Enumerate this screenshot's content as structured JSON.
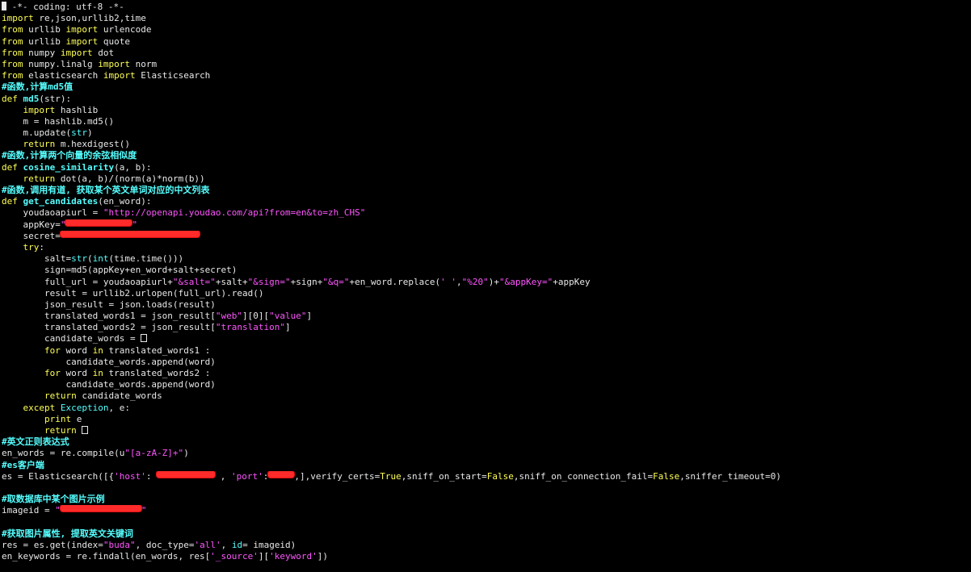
{
  "lines": [
    [
      {
        "t": "",
        "c": "cursor"
      },
      {
        "t": " -*- coding: utf-8 -*-",
        "c": "tok-plain"
      }
    ],
    [
      {
        "t": "import",
        "c": "tok-kw"
      },
      {
        "t": " re,json,urllib2,time",
        "c": "tok-plain"
      }
    ],
    [
      {
        "t": "from",
        "c": "tok-kw"
      },
      {
        "t": " urllib ",
        "c": "tok-plain"
      },
      {
        "t": "import",
        "c": "tok-kw"
      },
      {
        "t": " urlencode",
        "c": "tok-plain"
      }
    ],
    [
      {
        "t": "from",
        "c": "tok-kw"
      },
      {
        "t": " urllib ",
        "c": "tok-plain"
      },
      {
        "t": "import",
        "c": "tok-kw"
      },
      {
        "t": " quote",
        "c": "tok-plain"
      }
    ],
    [
      {
        "t": "from",
        "c": "tok-kw"
      },
      {
        "t": " numpy ",
        "c": "tok-plain"
      },
      {
        "t": "import",
        "c": "tok-kw"
      },
      {
        "t": " dot",
        "c": "tok-plain"
      }
    ],
    [
      {
        "t": "from",
        "c": "tok-kw"
      },
      {
        "t": " numpy.linalg ",
        "c": "tok-plain"
      },
      {
        "t": "import",
        "c": "tok-kw"
      },
      {
        "t": " norm",
        "c": "tok-plain"
      }
    ],
    [
      {
        "t": "from",
        "c": "tok-kw"
      },
      {
        "t": " elasticsearch ",
        "c": "tok-plain"
      },
      {
        "t": "import",
        "c": "tok-kw"
      },
      {
        "t": " Elasticsearch",
        "c": "tok-plain"
      }
    ],
    [
      {
        "t": "#函数,计算md5值",
        "c": "tok-cm"
      }
    ],
    [
      {
        "t": "def",
        "c": "tok-kw"
      },
      {
        "t": " ",
        "c": "tok-plain"
      },
      {
        "t": "md5",
        "c": "tok-def"
      },
      {
        "t": "(str):",
        "c": "tok-plain"
      }
    ],
    [
      {
        "t": "    ",
        "c": "tok-plain"
      },
      {
        "t": "import",
        "c": "tok-kw"
      },
      {
        "t": " hashlib",
        "c": "tok-plain"
      }
    ],
    [
      {
        "t": "    m = hashlib.md5()",
        "c": "tok-plain"
      }
    ],
    [
      {
        "t": "    m.update(",
        "c": "tok-plain"
      },
      {
        "t": "str",
        "c": "tok-bi"
      },
      {
        "t": ")",
        "c": "tok-plain"
      }
    ],
    [
      {
        "t": "    ",
        "c": "tok-plain"
      },
      {
        "t": "return",
        "c": "tok-kw"
      },
      {
        "t": " m.hexdigest()",
        "c": "tok-plain"
      }
    ],
    [
      {
        "t": "#函数,计算两个向量的余弦相似度",
        "c": "tok-cm"
      }
    ],
    [
      {
        "t": "def",
        "c": "tok-kw"
      },
      {
        "t": " ",
        "c": "tok-plain"
      },
      {
        "t": "cosine_similarity",
        "c": "tok-def"
      },
      {
        "t": "(a, b):",
        "c": "tok-plain"
      }
    ],
    [
      {
        "t": "    ",
        "c": "tok-plain"
      },
      {
        "t": "return",
        "c": "tok-kw"
      },
      {
        "t": " dot(a, b)/(norm(a)*norm(b))",
        "c": "tok-plain"
      }
    ],
    [
      {
        "t": "#函数,调用有道, 获取某个英文单词对应的中文列表",
        "c": "tok-cm"
      }
    ],
    [
      {
        "t": "def",
        "c": "tok-kw"
      },
      {
        "t": " ",
        "c": "tok-plain"
      },
      {
        "t": "get_candidates",
        "c": "tok-def"
      },
      {
        "t": "(en_word):",
        "c": "tok-plain"
      }
    ],
    [
      {
        "t": "    youdaoapiurl = ",
        "c": "tok-plain"
      },
      {
        "t": "\"http://openapi.youdao.com/api?from=en&to=zh_CHS\"",
        "c": "tok-str"
      }
    ],
    [
      {
        "t": "    appKey=",
        "c": "tok-plain"
      },
      {
        "t": "\"",
        "c": "tok-str"
      },
      {
        "t": "",
        "c": "redact",
        "w": 82
      },
      {
        "t": "\"",
        "c": "tok-str"
      }
    ],
    [
      {
        "t": "    secret=",
        "c": "tok-plain"
      },
      {
        "t": "",
        "c": "redact",
        "w": 172
      }
    ],
    [
      {
        "t": "    ",
        "c": "tok-plain"
      },
      {
        "t": "try",
        "c": "tok-kw"
      },
      {
        "t": ":",
        "c": "tok-plain"
      }
    ],
    [
      {
        "t": "        salt=",
        "c": "tok-plain"
      },
      {
        "t": "str",
        "c": "tok-bi"
      },
      {
        "t": "(",
        "c": "tok-plain"
      },
      {
        "t": "int",
        "c": "tok-bi"
      },
      {
        "t": "(time.time()))",
        "c": "tok-plain"
      }
    ],
    [
      {
        "t": "        sign=md5(appKey+en_word+salt+secret)",
        "c": "tok-plain"
      }
    ],
    [
      {
        "t": "        full_url = youdaoapiurl+",
        "c": "tok-plain"
      },
      {
        "t": "\"&salt=\"",
        "c": "tok-str"
      },
      {
        "t": "+salt+",
        "c": "tok-plain"
      },
      {
        "t": "\"&sign=\"",
        "c": "tok-str"
      },
      {
        "t": "+sign+",
        "c": "tok-plain"
      },
      {
        "t": "\"&q=\"",
        "c": "tok-str"
      },
      {
        "t": "+en_word.replace(",
        "c": "tok-plain"
      },
      {
        "t": "' '",
        "c": "tok-str"
      },
      {
        "t": ",",
        "c": "tok-plain"
      },
      {
        "t": "\"%20\"",
        "c": "tok-str"
      },
      {
        "t": ")+",
        "c": "tok-plain"
      },
      {
        "t": "\"&appKey=\"",
        "c": "tok-str"
      },
      {
        "t": "+appKey",
        "c": "tok-plain"
      }
    ],
    [
      {
        "t": "        result = urllib2.urlopen(full_url).read()",
        "c": "tok-plain"
      }
    ],
    [
      {
        "t": "        json_result = json.loads(result)",
        "c": "tok-plain"
      }
    ],
    [
      {
        "t": "        translated_words1 = json_result[",
        "c": "tok-plain"
      },
      {
        "t": "\"web\"",
        "c": "tok-str"
      },
      {
        "t": "][0][",
        "c": "tok-plain"
      },
      {
        "t": "\"value\"",
        "c": "tok-str"
      },
      {
        "t": "]",
        "c": "tok-plain"
      }
    ],
    [
      {
        "t": "        translated_words2 = json_result[",
        "c": "tok-plain"
      },
      {
        "t": "\"translation\"",
        "c": "tok-str"
      },
      {
        "t": "]",
        "c": "tok-plain"
      }
    ],
    [
      {
        "t": "        candidate_words = ",
        "c": "tok-plain"
      },
      {
        "t": "",
        "c": "box"
      }
    ],
    [
      {
        "t": "        ",
        "c": "tok-plain"
      },
      {
        "t": "for",
        "c": "tok-kw"
      },
      {
        "t": " word ",
        "c": "tok-plain"
      },
      {
        "t": "in",
        "c": "tok-kw"
      },
      {
        "t": " translated_words1 :",
        "c": "tok-plain"
      }
    ],
    [
      {
        "t": "            candidate_words.append(word)",
        "c": "tok-plain"
      }
    ],
    [
      {
        "t": "        ",
        "c": "tok-plain"
      },
      {
        "t": "for",
        "c": "tok-kw"
      },
      {
        "t": " word ",
        "c": "tok-plain"
      },
      {
        "t": "in",
        "c": "tok-kw"
      },
      {
        "t": " translated_words2 :",
        "c": "tok-plain"
      }
    ],
    [
      {
        "t": "            candidate_words.append(word)",
        "c": "tok-plain"
      }
    ],
    [
      {
        "t": "        ",
        "c": "tok-plain"
      },
      {
        "t": "return",
        "c": "tok-kw"
      },
      {
        "t": " candidate_words",
        "c": "tok-plain"
      }
    ],
    [
      {
        "t": "    ",
        "c": "tok-plain"
      },
      {
        "t": "except",
        "c": "tok-kw"
      },
      {
        "t": " ",
        "c": "tok-plain"
      },
      {
        "t": "Exception",
        "c": "tok-bi"
      },
      {
        "t": ", e:",
        "c": "tok-plain"
      }
    ],
    [
      {
        "t": "        ",
        "c": "tok-plain"
      },
      {
        "t": "print",
        "c": "tok-kw"
      },
      {
        "t": " e",
        "c": "tok-plain"
      }
    ],
    [
      {
        "t": "        ",
        "c": "tok-plain"
      },
      {
        "t": "return",
        "c": "tok-kw"
      },
      {
        "t": " ",
        "c": "tok-plain"
      },
      {
        "t": "",
        "c": "box"
      }
    ],
    [
      {
        "t": "#英文正则表达式",
        "c": "tok-cm"
      }
    ],
    [
      {
        "t": "en_words = re.compile(u",
        "c": "tok-plain"
      },
      {
        "t": "\"[a-zA-Z]+\"",
        "c": "tok-str"
      },
      {
        "t": ")",
        "c": "tok-plain"
      }
    ],
    [
      {
        "t": "#es客户端",
        "c": "tok-cm"
      }
    ],
    [
      {
        "t": "es = Elasticsearch([{",
        "c": "tok-plain"
      },
      {
        "t": "'host'",
        "c": "tok-str"
      },
      {
        "t": ": ",
        "c": "tok-plain"
      },
      {
        "t": "",
        "c": "redact",
        "w": 72
      },
      {
        "t": " , ",
        "c": "tok-plain"
      },
      {
        "t": "'port'",
        "c": "tok-str"
      },
      {
        "t": ":",
        "c": "tok-plain"
      },
      {
        "t": "",
        "c": "redact",
        "w": 32
      },
      {
        "t": ",],verify_certs=",
        "c": "tok-plain"
      },
      {
        "t": "True",
        "c": "tok-kw"
      },
      {
        "t": ",sniff_on_start=",
        "c": "tok-plain"
      },
      {
        "t": "False",
        "c": "tok-kw"
      },
      {
        "t": ",sniff_on_connection_fail=",
        "c": "tok-plain"
      },
      {
        "t": "False",
        "c": "tok-kw"
      },
      {
        "t": ",sniffer_timeout=0)",
        "c": "tok-plain"
      }
    ],
    [],
    [
      {
        "t": "#取数据库中某个图片示例",
        "c": "tok-cm"
      }
    ],
    [
      {
        "t": "imageid = ",
        "c": "tok-plain"
      },
      {
        "t": "\"",
        "c": "tok-str"
      },
      {
        "t": "",
        "c": "redact",
        "w": 100
      },
      {
        "t": "\"",
        "c": "tok-str"
      }
    ],
    [],
    [
      {
        "t": "#获取图片属性, 提取英文关键词",
        "c": "tok-cm"
      }
    ],
    [
      {
        "t": "res = es.get(index=",
        "c": "tok-plain"
      },
      {
        "t": "\"buda\"",
        "c": "tok-str"
      },
      {
        "t": ", doc_type=",
        "c": "tok-plain"
      },
      {
        "t": "'all'",
        "c": "tok-str"
      },
      {
        "t": ", ",
        "c": "tok-plain"
      },
      {
        "t": "id",
        "c": "tok-bi"
      },
      {
        "t": "= imageid)",
        "c": "tok-plain"
      }
    ],
    [
      {
        "t": "en_keywords = re.findall(en_words, res[",
        "c": "tok-plain"
      },
      {
        "t": "'_source'",
        "c": "tok-str"
      },
      {
        "t": "][",
        "c": "tok-plain"
      },
      {
        "t": "'keyword'",
        "c": "tok-str"
      },
      {
        "t": "])",
        "c": "tok-plain"
      }
    ]
  ]
}
